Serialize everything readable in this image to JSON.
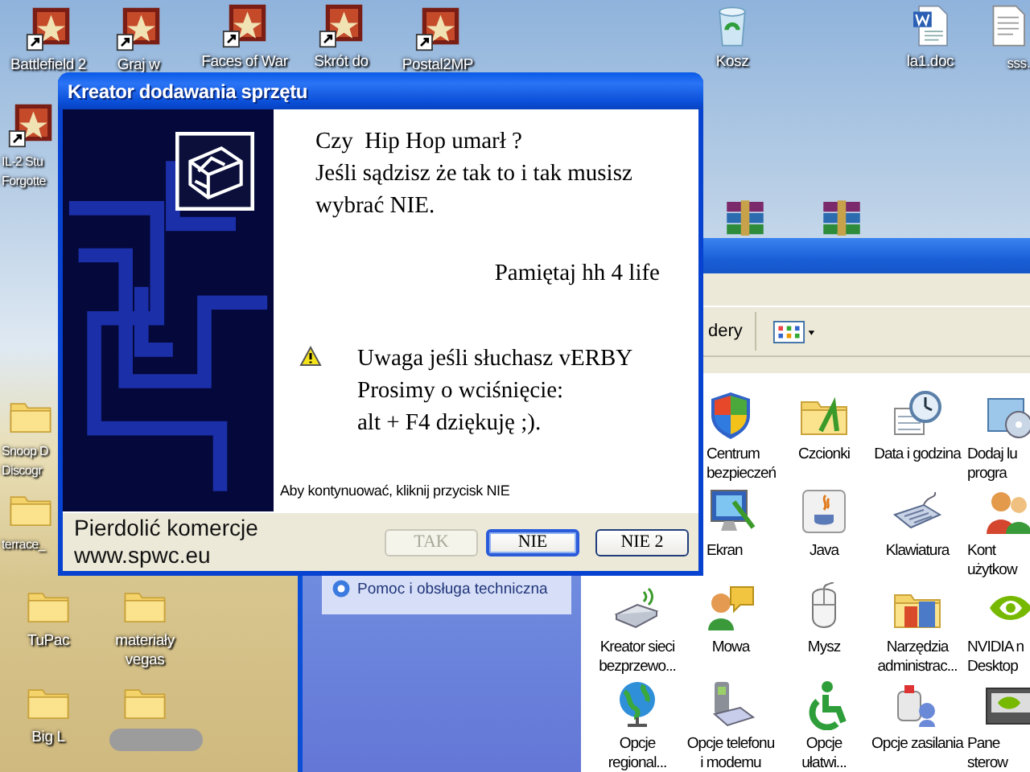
{
  "desktop": {
    "icons": [
      {
        "kind": "shortcut",
        "lines": [
          "Battlefield 2"
        ]
      },
      {
        "kind": "shortcut",
        "lines": [
          "Graj w"
        ]
      },
      {
        "kind": "shortcut",
        "lines": [
          "Faces of War"
        ]
      },
      {
        "kind": "shortcut",
        "lines": [
          "Skrót do"
        ]
      },
      {
        "kind": "shortcut",
        "lines": [
          "Postal2MP"
        ]
      },
      {
        "kind": "recycle-bin",
        "lines": [
          "Kosz"
        ]
      },
      {
        "kind": "document",
        "lines": [
          "la1.doc"
        ]
      },
      {
        "kind": "text-file",
        "lines": [
          "sss."
        ]
      },
      {
        "kind": "shortcut",
        "lines": [
          "IL-2 Stu",
          "Forgotte"
        ]
      },
      {
        "kind": "archive"
      },
      {
        "kind": "archive"
      },
      {
        "kind": "folder",
        "lines": [
          "Snoop D",
          "Discogr"
        ]
      },
      {
        "kind": "folder",
        "lines": [
          "terrace_"
        ]
      },
      {
        "kind": "folder",
        "lines": [
          "TuPac"
        ]
      },
      {
        "kind": "folder",
        "lines": [
          "materiały",
          "vegas"
        ]
      },
      {
        "kind": "folder",
        "lines": [
          "Big L"
        ]
      },
      {
        "kind": "folder",
        "redacted": true
      }
    ]
  },
  "explorer": {
    "toolbar": {
      "folders_label": "dery"
    },
    "task_pane": {
      "items": [
        "Pomoc i obsługa techniczna"
      ]
    },
    "rows": [
      {
        "items": [
          {
            "kind": "security",
            "lines": [
              "Centrum",
              "bezpieczeń"
            ]
          },
          {
            "kind": "fonts",
            "lines": [
              "Czcionki"
            ]
          },
          {
            "kind": "datetime",
            "lines": [
              "Data i godzina"
            ]
          },
          {
            "kind": "addremove",
            "lines": [
              "Dodaj lu",
              "progra"
            ]
          }
        ]
      },
      {
        "items": [
          {
            "kind": "display",
            "lines": [
              "Ekran"
            ]
          },
          {
            "kind": "java",
            "lines": [
              "Java"
            ]
          },
          {
            "kind": "keyboard",
            "lines": [
              "Klawiatura"
            ]
          },
          {
            "kind": "users",
            "lines": [
              "Kont",
              "użytkow"
            ]
          }
        ]
      },
      {
        "items": [
          {
            "kind": "wireless",
            "lines": [
              "Kreator sieci",
              "bezprzewo..."
            ]
          },
          {
            "kind": "speech",
            "lines": [
              "Mowa"
            ]
          },
          {
            "kind": "mouse",
            "lines": [
              "Mysz"
            ]
          },
          {
            "kind": "admin",
            "lines": [
              "Narzędzia",
              "administrac..."
            ]
          },
          {
            "kind": "nvidia",
            "lines": [
              "NVIDIA n",
              "Desktop"
            ]
          }
        ]
      },
      {
        "items": [
          {
            "kind": "regional",
            "lines": [
              "Opcje",
              "regional..."
            ]
          },
          {
            "kind": "phone",
            "lines": [
              "Opcje telefonu",
              "i modemu"
            ]
          },
          {
            "kind": "accessibility",
            "lines": [
              "Opcje",
              "ułatwi..."
            ]
          },
          {
            "kind": "power",
            "lines": [
              "Opcje zasilania"
            ]
          },
          {
            "kind": "panel",
            "lines": [
              "Pane",
              "sterow"
            ]
          }
        ]
      }
    ]
  },
  "dialog": {
    "title": "Kreator dodawania sprzętu",
    "message": [
      "Czy  Hip Hop umarł ?",
      "Jeśli sądzisz że tak to i tak musisz",
      "wybrać NIE."
    ],
    "reminder": "Pamiętaj hh 4 life",
    "warning": [
      "Uwaga jeśli słuchasz vERBY",
      "Prosimy o wciśnięcie:",
      "alt + F4 dziękuję ;)."
    ],
    "hint": "Aby kontynuować, kliknij przycisk NIE",
    "footer": [
      "Pierdolić komercje",
      "www.spwc.eu"
    ],
    "buttons": [
      {
        "label": "TAK",
        "disabled": true,
        "default": false
      },
      {
        "label": "NIE",
        "disabled": false,
        "default": true
      },
      {
        "label": "NIE 2",
        "disabled": false,
        "default": false
      }
    ]
  }
}
